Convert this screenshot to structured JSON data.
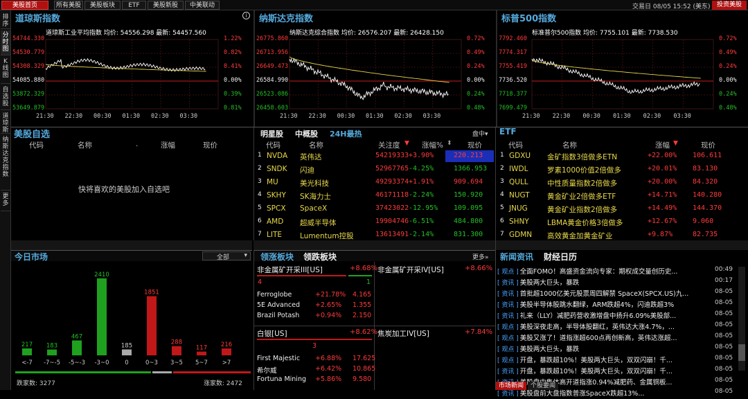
{
  "topbar": {
    "tabs": [
      {
        "label": "美股首页",
        "active": true
      },
      {
        "label": "所有美股"
      },
      {
        "label": "美股板块"
      },
      {
        "label": "ETF"
      },
      {
        "label": "美股新股"
      },
      {
        "label": "中美联动"
      }
    ],
    "session": "交易日 08/05 15:52 (美东)",
    "invest_button": "投资美股"
  },
  "leftbar": [
    "排序",
    "分时图",
    "K线图",
    "自选股",
    "道琼斯",
    "纳斯达克指数",
    "更多"
  ],
  "charts": [
    {
      "title": "道琼斯指数",
      "subtitle": "道琼斯工业平均指数 均价: 54556.298 最新: 54457.560",
      "ylabels": [
        "54744.330",
        "54530.779",
        "54308.329",
        "54085.880",
        "53872.329",
        "53649.879"
      ],
      "pct": [
        "1.22%",
        "0.82%",
        "0.41%",
        "0.00%",
        "0.39%",
        "0.81%"
      ],
      "xlabels": [
        "21:30",
        "22:30",
        "00:30",
        "01:30",
        "02:30",
        "03:30"
      ]
    },
    {
      "title": "纳斯达克指数",
      "subtitle": "纳斯达克综合指数 均价: 26576.207 最新: 26428.150",
      "ylabels": [
        "26775.860",
        "26713.956",
        "26649.473",
        "26584.990",
        "26523.086",
        "26458.603"
      ],
      "pct": [
        "0.72%",
        "0.49%",
        "0.24%",
        "0.00%",
        "0.24%",
        "0.48%"
      ],
      "xlabels": [
        "21:30",
        "22:30",
        "00:30",
        "01:30",
        "02:30",
        "03:30"
      ]
    },
    {
      "title": "标普500指数",
      "subtitle": "标准普尔500指数 均价: 7755.101 最新: 7738.530",
      "ylabels": [
        "7792.460",
        "7774.317",
        "7755.419",
        "7736.520",
        "7718.377",
        "7699.479"
      ],
      "pct": [
        "0.72%",
        "0.49%",
        "0.24%",
        "0.00%",
        "0.24%",
        "0.48%"
      ],
      "xlabels": [
        "21:30",
        "22:30",
        "00:30",
        "01:30",
        "02:30",
        "03:30"
      ]
    }
  ],
  "watchlist": {
    "title": "美股自选",
    "headers": [
      "代码",
      "名称",
      ".",
      "涨幅",
      "现价"
    ],
    "empty": "快将喜欢的美股加入自选吧"
  },
  "stars": {
    "tabs": [
      "明星股",
      "中概股",
      "24H最热"
    ],
    "disk": "盘中",
    "headers": [
      "代码",
      "名称",
      "关注度",
      "涨幅%",
      "现价"
    ],
    "rows": [
      [
        "1",
        "NVDA",
        "英伟达",
        "54219333",
        "+3.90%",
        "220.213"
      ],
      [
        "2",
        "SNDK",
        "闪迪",
        "52967765",
        "-4.25%",
        "1366.953"
      ],
      [
        "3",
        "MU",
        "美光科技",
        "49293374",
        "+1.91%",
        "909.694"
      ],
      [
        "4",
        "SKHY",
        "SK海力士",
        "46171118",
        "-2.24%",
        "150.920"
      ],
      [
        "5",
        "SPCX",
        "SpaceX",
        "37423022",
        "-12.95%",
        "109.095"
      ],
      [
        "6",
        "AMD",
        "超威半导体",
        "19904746",
        "-6.51%",
        "484.800"
      ],
      [
        "7",
        "LITE",
        "Lumentum控股",
        "13613491",
        "-2.14%",
        "831.300"
      ]
    ]
  },
  "etf": {
    "title": "ETF",
    "headers": [
      "代码",
      "名称",
      "涨幅",
      "现价"
    ],
    "rows": [
      [
        "1",
        "GDXU",
        "金矿指数3倍做多ETN",
        "+22.00%",
        "106.611"
      ],
      [
        "2",
        "IWDL",
        "罗素1000价值2倍做多",
        "+20.01%",
        "83.130"
      ],
      [
        "3",
        "QULL",
        "中性质量指数2倍做多",
        "+20.00%",
        "84.320"
      ],
      [
        "4",
        "NUGT",
        "黄金矿业2倍做多ETF",
        "+14.71%",
        "140.280"
      ],
      [
        "5",
        "JNUG",
        "黄金矿业指数2倍做多",
        "+14.49%",
        "144.370"
      ],
      [
        "6",
        "SHNY",
        "LBMA黄金价格3倍做多",
        "+12.67%",
        "9.060"
      ],
      [
        "7",
        "GDMN",
        "高效黄金加黄金矿业",
        "+9.87%",
        "82.735"
      ]
    ]
  },
  "market": {
    "title": "今日市场",
    "filter": "全部",
    "chart_data": {
      "type": "bar",
      "categories": [
        "<-7",
        "-7~-5",
        "-5~-3",
        "-3~0",
        "0",
        "0~3",
        "3~5",
        "5~7",
        ">7"
      ],
      "values": [
        217,
        183,
        467,
        2410,
        185,
        1851,
        288,
        117,
        216
      ]
    },
    "fall_label": "跌家数: 3277",
    "rise_label": "涨家数: 2472"
  },
  "sectors": {
    "tabs": [
      "领涨板块",
      "领跌板块"
    ],
    "more": "更多",
    "cells": [
      {
        "name": "非金属矿开采III[US]",
        "pct": "+8.68%",
        "up": "4",
        "down": "1",
        "rows": [
          [
            "Ferroglobe",
            "+21.78%",
            "4.165"
          ],
          [
            "5E Advanced",
            "+2.65%",
            "1.355"
          ],
          [
            "Brazil Potash",
            "+0.94%",
            "2.150"
          ]
        ]
      },
      {
        "name": "非金属矿开采IV[US]",
        "pct": "+8.66%"
      },
      {
        "name": "白银[US]",
        "pct": "+8.62%",
        "up": "3",
        "rows": [
          [
            "First Majestic",
            "+6.88%",
            "17.625"
          ],
          [
            "希尔威",
            "+6.42%",
            "10.865"
          ],
          [
            "Fortuna Mining",
            "+5.86%",
            "9.580"
          ]
        ]
      },
      {
        "name": "焦炭加工IV[US]",
        "pct": "+7.84%"
      }
    ]
  },
  "news": {
    "tabs": [
      "新闻资讯",
      "财经日历"
    ],
    "rows": [
      [
        "观点",
        "全面FOMO！高盛资金流向专家：期权成交量创历史...",
        "00:49"
      ],
      [
        "资讯",
        "美股两大巨头，暴跌",
        "00:17"
      ],
      [
        "资讯",
        "首批超1000亿美元股票周四解禁 SpaceX(SPCX.US)九...",
        "08-05"
      ],
      [
        "资讯",
        "美股半导体股跳水翻绿，ARM跌超4%，闪迪跌超3%",
        "08-05"
      ],
      [
        "资讯",
        "礼来（LLY）减肥药营收激增盘中扬升6.09%美股部...",
        "08-05"
      ],
      [
        "观点",
        "美股深夜走高，半导体股翻红，英伟达大涨4.7%，...",
        "08-05"
      ],
      [
        "观点",
        "美股又涨了！道指涨超600点再创新高，英伟达涨超...",
        "08-05"
      ],
      [
        "观点",
        "美股两大巨头，暴跌",
        "08-05"
      ],
      [
        "观点",
        "开盘，暴跌超10%！美股两大巨头，双双闪崩！千...",
        "08-05"
      ],
      [
        "资讯",
        "开盘，暴跌超10%！美股两大巨头，双双闪崩！千...",
        "08-05"
      ],
      [
        "资讯",
        "美股盘中集体高开道指涨0.94%减肥药、金属铜板...",
        "08-05"
      ],
      [
        "资讯",
        "美股盘前大盘指数普涨SpaceX跌超13%...",
        "08-05"
      ]
    ],
    "bottom_tabs": [
      "市场新闻",
      "个股要闻"
    ]
  },
  "colors": {
    "up": "#ff3b3b",
    "down": "#24c024",
    "accent": "#5ad"
  }
}
